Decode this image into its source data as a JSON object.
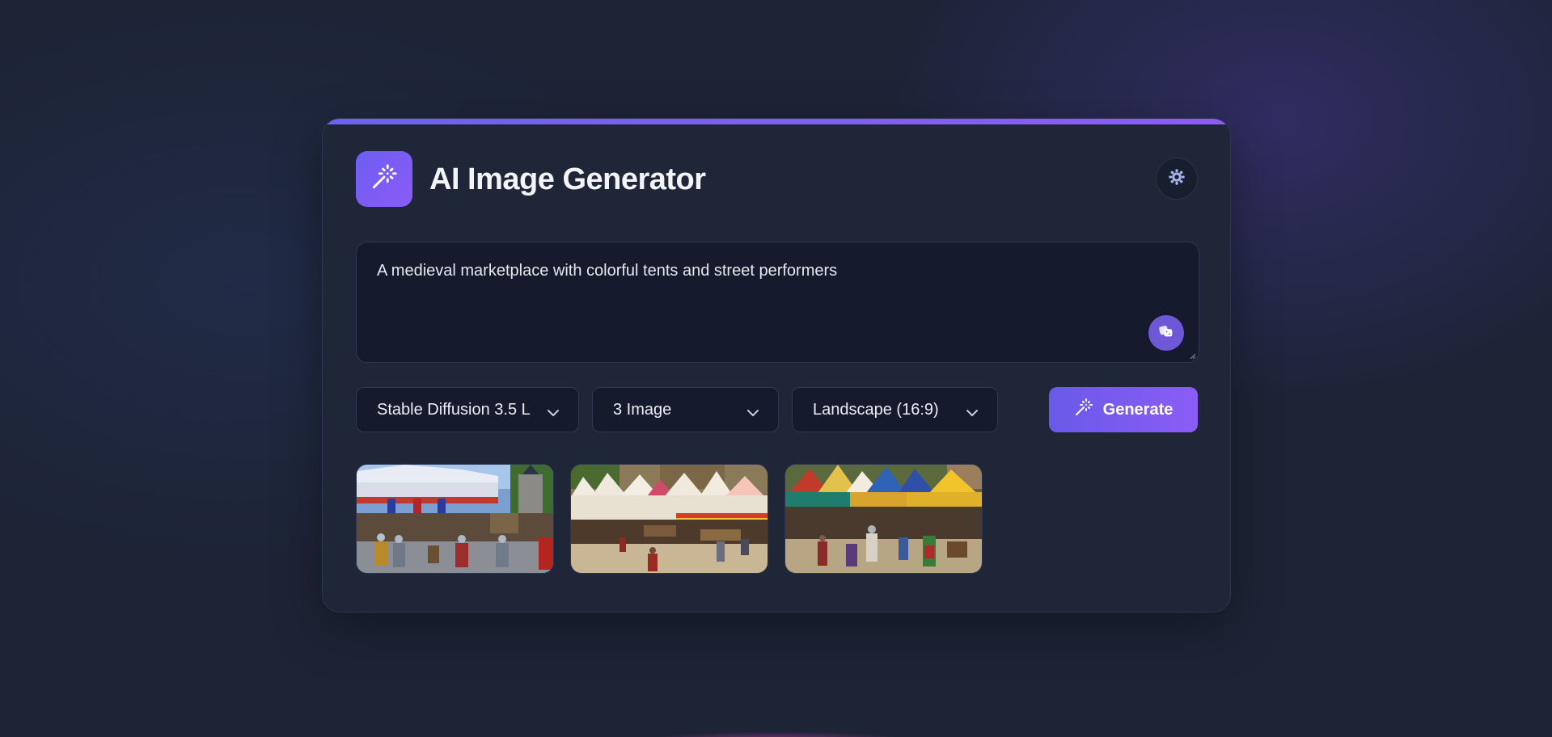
{
  "app": {
    "title": "AI Image Generator"
  },
  "header": {
    "logo_icon": "magic-wand-sparkles-icon",
    "theme_toggle_icon": "sun-gear-icon"
  },
  "prompt": {
    "value": "A medieval marketplace with colorful tents and street performers",
    "enhance_icon": "dice-icon"
  },
  "controls": {
    "model": "Stable Diffusion 3.5 L",
    "count": "3 Image",
    "aspect_ratio": "Landscape (16:9)",
    "generate_label": "Generate",
    "generate_icon": "magic-wand-icon"
  },
  "gallery": {
    "images": [
      {
        "alt": "medieval-market-image-1"
      },
      {
        "alt": "medieval-market-image-2"
      },
      {
        "alt": "medieval-market-image-3"
      }
    ]
  },
  "colors": {
    "background": "#1d2436",
    "card": "#1e2638",
    "accent": "#7c5cf4",
    "input_bg": "#151b2c"
  }
}
